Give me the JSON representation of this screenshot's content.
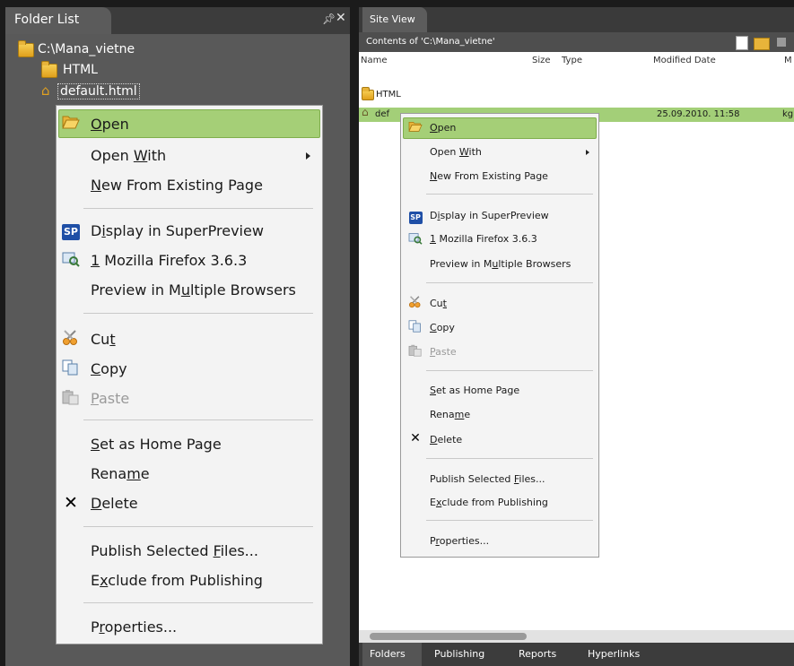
{
  "left_panel": {
    "title": "Folder List",
    "pin_icon": "pin-icon",
    "close_icon": "close-icon",
    "tree": {
      "root": "C:\\Mana_vietne",
      "html_folder": "HTML",
      "selected_file": "default.html"
    },
    "context_menu": {
      "open": "Open",
      "open_with": "Open With",
      "new_from_existing": "New From Existing Page",
      "display_superpreview": "Display in SuperPreview",
      "firefox": "1 Mozilla Firefox 3.6.3",
      "preview_multiple": "Preview in Multiple Browsers",
      "cut": "Cut",
      "copy": "Copy",
      "paste": "Paste",
      "set_home": "Set as Home Page",
      "rename": "Rename",
      "delete": "Delete",
      "publish_selected": "Publish Selected Files...",
      "exclude": "Exclude from Publishing",
      "properties": "Properties..."
    }
  },
  "right_panel": {
    "tab_title": "Site View",
    "contents_label": "Contents of 'C:\\Mana_vietne'",
    "columns": {
      "name": "Name",
      "size": "Size",
      "type": "Type",
      "modified": "Modified Date",
      "m": "M"
    },
    "rows": {
      "html": "HTML",
      "default_name": "def",
      "default_modified": "25.09.2010. 11:58",
      "default_m": "kg"
    },
    "context_menu": {
      "open": "Open",
      "open_with": "Open With",
      "new_from_existing": "New From Existing Page",
      "display_superpreview": "Display in SuperPreview",
      "firefox": "1 Mozilla Firefox 3.6.3",
      "preview_multiple": "Preview in Multiple Browsers",
      "cut": "Cut",
      "copy": "Copy",
      "paste": "Paste",
      "set_home": "Set as Home Page",
      "rename": "Rename",
      "delete": "Delete",
      "publish_selected": "Publish Selected Files...",
      "exclude": "Exclude from Publishing",
      "properties": "Properties..."
    },
    "bottom_tabs": [
      "Folders",
      "Publishing",
      "Reports",
      "Hyperlinks"
    ]
  },
  "icons": {
    "open": "open-folder-icon",
    "superpreview": "superpreview-icon",
    "firefox": "browser-preview-icon",
    "cut": "scissors-icon",
    "copy": "copy-icon",
    "paste": "paste-icon",
    "delete": "delete-x-icon"
  },
  "colors": {
    "highlight": "#a5cf77",
    "panel_dark": "#595959",
    "superpreview_blue": "#1f4fa6"
  }
}
